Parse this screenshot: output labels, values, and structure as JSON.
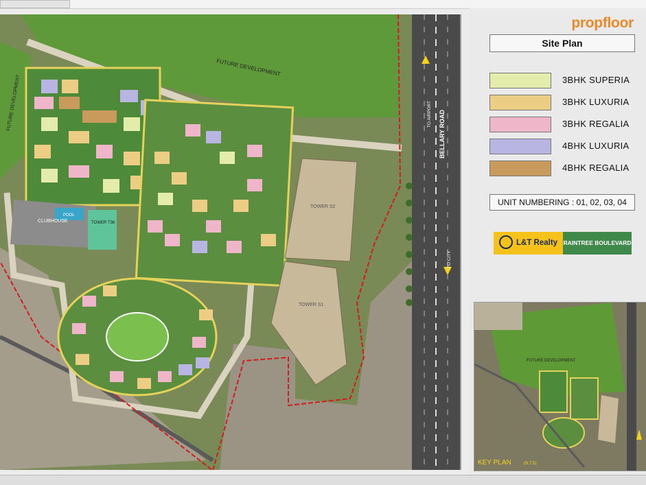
{
  "brand": {
    "name": "propfloor"
  },
  "panel": {
    "title": "Site Plan",
    "unit_numbering": "UNIT NUMBERING : 01, 02, 03, 04",
    "logo_primary": "L&T Realty",
    "logo_secondary": "RAINTREE BOULEVARD"
  },
  "legend": [
    {
      "label": "3BHK SUPERIA",
      "color": "#e3ecaa"
    },
    {
      "label": "3BHK LUXURIA",
      "color": "#eccd84"
    },
    {
      "label": "3BHK REGALIA",
      "color": "#efb5c9"
    },
    {
      "label": "4BHK LUXURIA",
      "color": "#b9b5e3"
    },
    {
      "label": "4BHK REGALIA",
      "color": "#c89a5c"
    }
  ],
  "map_labels": {
    "future_dev": "FUTURE DEVELOPMENT",
    "future_dev_left": "FUTURE DEVELOPMENT",
    "road": "BELLARY ROAD",
    "to_airport": "TO AIRPORT",
    "to_city": "TO CITY",
    "tower_s2": "TOWER S2",
    "tower_s1": "TOWER S1",
    "clubhouse": "CLUBHOUSE",
    "pool": "POOL",
    "tower_t36": "TOWER T36"
  },
  "key_plan": {
    "label": "KEY PLAN",
    "nts": "(N.T.S)",
    "future_dev": "FUTURE DEVELOPMENT"
  }
}
